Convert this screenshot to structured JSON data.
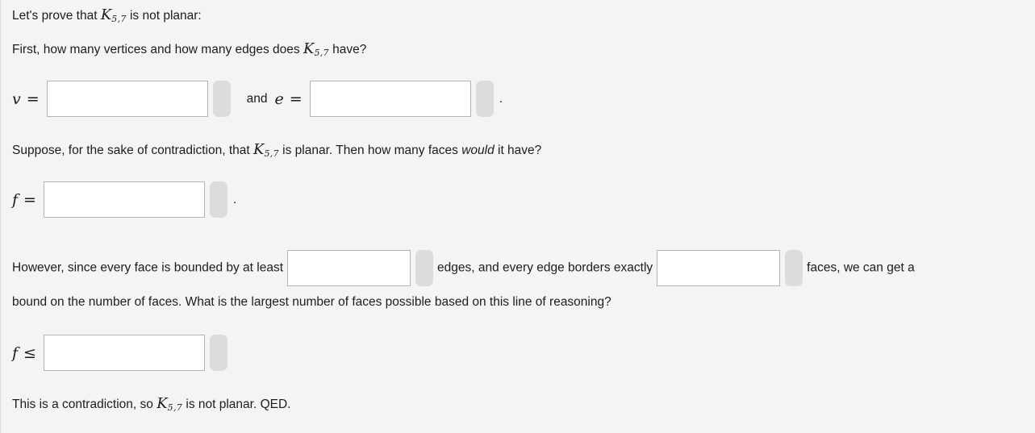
{
  "document": {
    "background_color": "#f4f4f4",
    "text_color": "#1d1d1d",
    "input_border_color": "#b4b4b4",
    "tab_color": "#dcdcdc",
    "graph_label": "K",
    "graph_subscript": "5,7"
  },
  "lines": {
    "intro_before": "Let's prove that",
    "intro_after": "is not planar:",
    "question1_before": "First, how many vertices and how many edges does",
    "question1_after": "have?",
    "question2_before": "Suppose, for the sake of contradiction, that",
    "question2_mid": "is planar. Then how many faces",
    "question2_italic": "would",
    "question2_after": "it have?",
    "however_before": "However, since every face is bounded by at least",
    "however_mid": "edges, and every edge borders exactly",
    "however_after": "faces, we can get a",
    "bound_line": "bound on the number of faces. What is the largest number of faces possible based on this line of reasoning?",
    "conclusion_before": "This is a contradiction, so",
    "conclusion_after": "is not planar. QED."
  },
  "answers": {
    "v_label": "v",
    "v_relation": "=",
    "v_value": "",
    "v_placeholder": "",
    "conjunction": "and",
    "e_label": "e",
    "e_relation": "=",
    "e_value": "",
    "e_placeholder": "",
    "period_after_e": ".",
    "f_label": "f",
    "f_relation": "=",
    "f_value": "",
    "f_placeholder": "",
    "period_after_f": ".",
    "edges_per_face_value": "",
    "edges_per_face_placeholder": "",
    "faces_per_edge_value": "",
    "faces_per_edge_placeholder": "",
    "f_bound_label": "f",
    "f_bound_relation": "≤",
    "f_bound_value": "",
    "f_bound_placeholder": ""
  }
}
